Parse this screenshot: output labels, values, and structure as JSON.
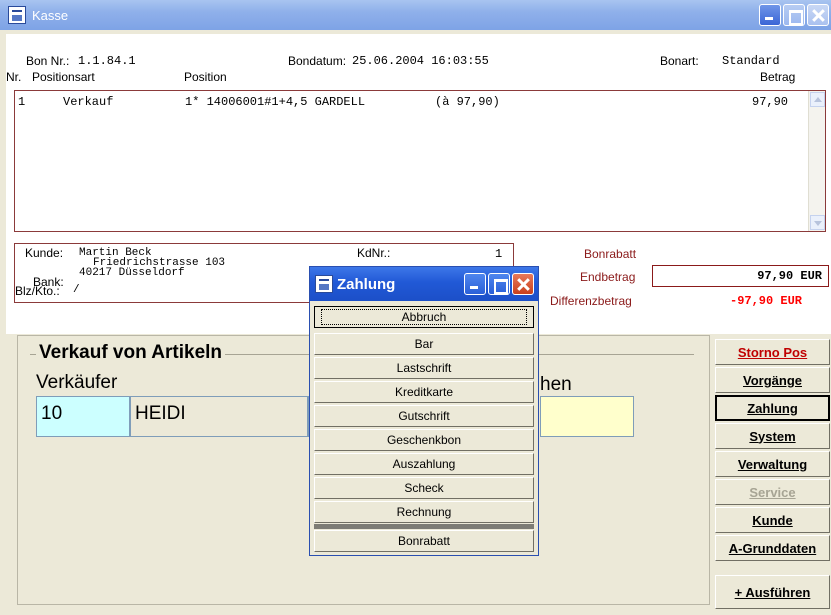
{
  "window": {
    "title": "Kasse"
  },
  "header": {
    "bon_nr_label": "Bon Nr.:",
    "bon_nr_value": "1.1.84.1",
    "bondatum_label": "Bondatum:",
    "bondatum_value": "25.06.2004 16:03:55",
    "bonart_label": "Bonart:",
    "bonart_value": "Standard",
    "col_nr": "Nr.",
    "col_positionsart": "Positionsart",
    "col_position": "Position",
    "col_betrag": "Betrag"
  },
  "items": [
    {
      "nr": "1",
      "art": "Verkauf",
      "position": "1* 14006001#1+4,5 GARDELL",
      "unit": "(à    97,90)",
      "betrag": "97,90"
    }
  ],
  "customer": {
    "kunde_label": "Kunde:",
    "name": "Martin Beck",
    "street": "Friedrichstrasse 103",
    "city": "40217 Düsseldorf",
    "bank_label": "Bank:",
    "blz_label": "Blz/Kto.:",
    "blz_value": "/",
    "kdnr_label": "KdNr.:",
    "kdnr_value": "1"
  },
  "totals": {
    "bonrabatt_label": "Bonrabatt",
    "endbetrag_label": "Endbetrag",
    "endbetrag_value": "97,90 EUR",
    "differenz_label": "Differenzbetrag",
    "differenz_value": "-97,90 EUR"
  },
  "lower": {
    "group_title": "Verkauf von Artikeln",
    "seller_label": "Verkäufer",
    "seller_id": "10",
    "seller_name": "HEIDI",
    "partial_label": "hen"
  },
  "sidebar": {
    "storno": "Storno Pos",
    "vorgaenge": "Vorgänge",
    "zahlung": "Zahlung",
    "system": "System",
    "verwaltung": "Verwaltung",
    "service": "Service",
    "kunde": "Kunde",
    "grunddaten": "A-Grunddaten",
    "ausfuehren": "+ Ausführen"
  },
  "dialog": {
    "title": "Zahlung",
    "buttons": [
      "Abbruch",
      "Bar",
      "Lastschrift",
      "Kreditkarte",
      "Gutschrift",
      "Geschenkbon",
      "Auszahlung",
      "Scheck",
      "Rechnung"
    ],
    "bonrabatt": "Bonrabatt"
  },
  "colors": {
    "accent_red": "#c00000",
    "title_blue": "#2159d6",
    "seller_id_bg": "#ccffff",
    "field_yellow": "#ffffcc"
  }
}
